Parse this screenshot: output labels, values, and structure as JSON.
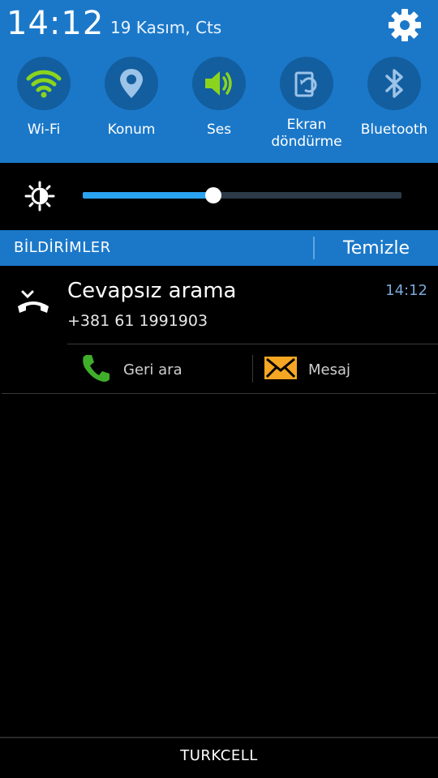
{
  "status": {
    "time": "14:12",
    "date": "19 Kasım, Cts",
    "settings_icon": "gear-icon"
  },
  "quick_toggles": [
    {
      "label": "Wi-Fi",
      "icon": "wifi-icon",
      "active": true
    },
    {
      "label": "Konum",
      "icon": "location-icon",
      "active": false
    },
    {
      "label": "Ses",
      "icon": "sound-icon",
      "active": true
    },
    {
      "label": "Ekran\ndöndürme",
      "icon": "rotate-icon",
      "active": false
    },
    {
      "label": "Bluetooth",
      "icon": "bluetooth-icon",
      "active": false
    }
  ],
  "brightness": {
    "icon": "brightness-icon",
    "level": 0.41
  },
  "notifications_header": {
    "title": "BİLDİRİMLER",
    "clear_label": "Temizle"
  },
  "notification": {
    "title": "Cevapsız arama",
    "number": "+381 61 1991903",
    "time": "14:12",
    "icon": "missed-call-icon",
    "actions": [
      {
        "label": "Geri ara",
        "icon": "phone-icon"
      },
      {
        "label": "Mesaj",
        "icon": "message-icon"
      }
    ]
  },
  "carrier": "TURKCELL",
  "colors": {
    "panel_blue": "#1b78c9",
    "toggle_circle": "#135e9f",
    "active_green": "#8bd41e",
    "slider_fill": "#2aa3f0",
    "time_blue": "#79a9d8",
    "message_orange": "#f5a623"
  }
}
